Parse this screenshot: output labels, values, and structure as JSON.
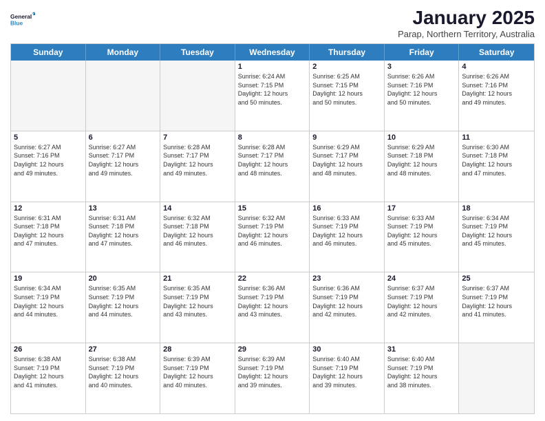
{
  "logo": {
    "line1": "General",
    "line2": "Blue"
  },
  "header": {
    "month": "January 2025",
    "location": "Parap, Northern Territory, Australia"
  },
  "days": [
    "Sunday",
    "Monday",
    "Tuesday",
    "Wednesday",
    "Thursday",
    "Friday",
    "Saturday"
  ],
  "rows": [
    [
      {
        "num": "",
        "info": ""
      },
      {
        "num": "",
        "info": ""
      },
      {
        "num": "",
        "info": ""
      },
      {
        "num": "1",
        "info": "Sunrise: 6:24 AM\nSunset: 7:15 PM\nDaylight: 12 hours\nand 50 minutes."
      },
      {
        "num": "2",
        "info": "Sunrise: 6:25 AM\nSunset: 7:15 PM\nDaylight: 12 hours\nand 50 minutes."
      },
      {
        "num": "3",
        "info": "Sunrise: 6:26 AM\nSunset: 7:16 PM\nDaylight: 12 hours\nand 50 minutes."
      },
      {
        "num": "4",
        "info": "Sunrise: 6:26 AM\nSunset: 7:16 PM\nDaylight: 12 hours\nand 49 minutes."
      }
    ],
    [
      {
        "num": "5",
        "info": "Sunrise: 6:27 AM\nSunset: 7:16 PM\nDaylight: 12 hours\nand 49 minutes."
      },
      {
        "num": "6",
        "info": "Sunrise: 6:27 AM\nSunset: 7:17 PM\nDaylight: 12 hours\nand 49 minutes."
      },
      {
        "num": "7",
        "info": "Sunrise: 6:28 AM\nSunset: 7:17 PM\nDaylight: 12 hours\nand 49 minutes."
      },
      {
        "num": "8",
        "info": "Sunrise: 6:28 AM\nSunset: 7:17 PM\nDaylight: 12 hours\nand 48 minutes."
      },
      {
        "num": "9",
        "info": "Sunrise: 6:29 AM\nSunset: 7:17 PM\nDaylight: 12 hours\nand 48 minutes."
      },
      {
        "num": "10",
        "info": "Sunrise: 6:29 AM\nSunset: 7:18 PM\nDaylight: 12 hours\nand 48 minutes."
      },
      {
        "num": "11",
        "info": "Sunrise: 6:30 AM\nSunset: 7:18 PM\nDaylight: 12 hours\nand 47 minutes."
      }
    ],
    [
      {
        "num": "12",
        "info": "Sunrise: 6:31 AM\nSunset: 7:18 PM\nDaylight: 12 hours\nand 47 minutes."
      },
      {
        "num": "13",
        "info": "Sunrise: 6:31 AM\nSunset: 7:18 PM\nDaylight: 12 hours\nand 47 minutes."
      },
      {
        "num": "14",
        "info": "Sunrise: 6:32 AM\nSunset: 7:18 PM\nDaylight: 12 hours\nand 46 minutes."
      },
      {
        "num": "15",
        "info": "Sunrise: 6:32 AM\nSunset: 7:19 PM\nDaylight: 12 hours\nand 46 minutes."
      },
      {
        "num": "16",
        "info": "Sunrise: 6:33 AM\nSunset: 7:19 PM\nDaylight: 12 hours\nand 46 minutes."
      },
      {
        "num": "17",
        "info": "Sunrise: 6:33 AM\nSunset: 7:19 PM\nDaylight: 12 hours\nand 45 minutes."
      },
      {
        "num": "18",
        "info": "Sunrise: 6:34 AM\nSunset: 7:19 PM\nDaylight: 12 hours\nand 45 minutes."
      }
    ],
    [
      {
        "num": "19",
        "info": "Sunrise: 6:34 AM\nSunset: 7:19 PM\nDaylight: 12 hours\nand 44 minutes."
      },
      {
        "num": "20",
        "info": "Sunrise: 6:35 AM\nSunset: 7:19 PM\nDaylight: 12 hours\nand 44 minutes."
      },
      {
        "num": "21",
        "info": "Sunrise: 6:35 AM\nSunset: 7:19 PM\nDaylight: 12 hours\nand 43 minutes."
      },
      {
        "num": "22",
        "info": "Sunrise: 6:36 AM\nSunset: 7:19 PM\nDaylight: 12 hours\nand 43 minutes."
      },
      {
        "num": "23",
        "info": "Sunrise: 6:36 AM\nSunset: 7:19 PM\nDaylight: 12 hours\nand 42 minutes."
      },
      {
        "num": "24",
        "info": "Sunrise: 6:37 AM\nSunset: 7:19 PM\nDaylight: 12 hours\nand 42 minutes."
      },
      {
        "num": "25",
        "info": "Sunrise: 6:37 AM\nSunset: 7:19 PM\nDaylight: 12 hours\nand 41 minutes."
      }
    ],
    [
      {
        "num": "26",
        "info": "Sunrise: 6:38 AM\nSunset: 7:19 PM\nDaylight: 12 hours\nand 41 minutes."
      },
      {
        "num": "27",
        "info": "Sunrise: 6:38 AM\nSunset: 7:19 PM\nDaylight: 12 hours\nand 40 minutes."
      },
      {
        "num": "28",
        "info": "Sunrise: 6:39 AM\nSunset: 7:19 PM\nDaylight: 12 hours\nand 40 minutes."
      },
      {
        "num": "29",
        "info": "Sunrise: 6:39 AM\nSunset: 7:19 PM\nDaylight: 12 hours\nand 39 minutes."
      },
      {
        "num": "30",
        "info": "Sunrise: 6:40 AM\nSunset: 7:19 PM\nDaylight: 12 hours\nand 39 minutes."
      },
      {
        "num": "31",
        "info": "Sunrise: 6:40 AM\nSunset: 7:19 PM\nDaylight: 12 hours\nand 38 minutes."
      },
      {
        "num": "",
        "info": ""
      }
    ]
  ]
}
